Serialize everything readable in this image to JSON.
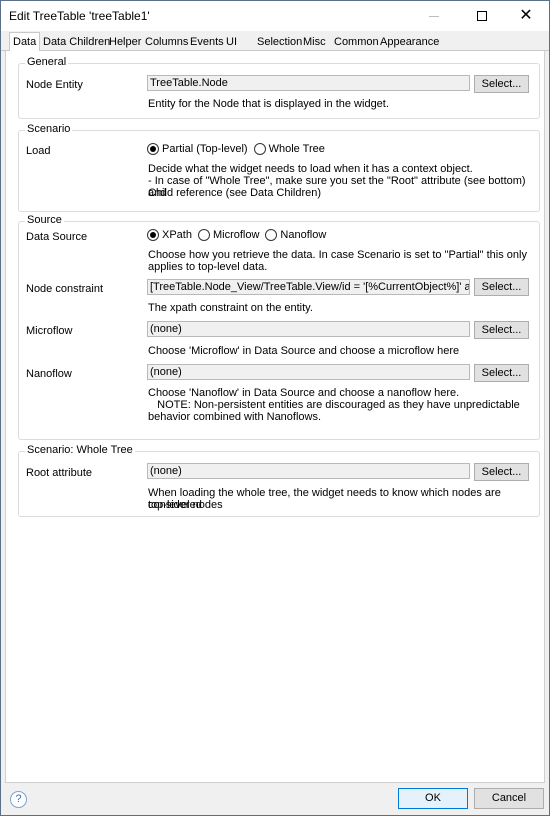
{
  "window": {
    "title": "Edit TreeTable 'treeTable1'"
  },
  "tabs": [
    {
      "label": "Data"
    },
    {
      "label": "Data Children"
    },
    {
      "label": "Helper"
    },
    {
      "label": "Columns"
    },
    {
      "label": "Events"
    },
    {
      "label": "UI"
    },
    {
      "label": "Selection"
    },
    {
      "label": "Misc"
    },
    {
      "label": "Common"
    },
    {
      "label": "Appearance"
    }
  ],
  "general": {
    "title": "General",
    "node_entity_label": "Node Entity",
    "node_entity_value": "TreeTable.Node",
    "select_label": "Select...",
    "help": "Entity for the Node that is displayed in the widget."
  },
  "scenario": {
    "title": "Scenario",
    "load_label": "Load",
    "options": [
      "Partial (Top-level)",
      "Whole Tree"
    ],
    "selected": "Partial (Top-level)",
    "help1": "Decide what the widget needs to load when it has a context object.",
    "help2": "- In case of \"Whole Tree\", make sure you set the \"Root\" attribute (see bottom) and",
    "help3": "Child reference (see Data Children)"
  },
  "source": {
    "title": "Source",
    "data_source_label": "Data Source",
    "options": [
      "XPath",
      "Microflow",
      "Nanoflow"
    ],
    "selected": "XPath",
    "data_source_help1": "Choose how you retrieve the data. In case Scenario is set to \"Partial\" this only",
    "data_source_help2": "applies to top-level data.",
    "node_constraint_label": "Node constraint",
    "node_constraint_value": "[TreeTable.Node_View/TreeTable.View/id = '[%CurrentObject%]' and _Ro",
    "node_constraint_help": "The xpath constraint on the entity.",
    "microflow_label": "Microflow",
    "microflow_value": "(none)",
    "microflow_help": "Choose 'Microflow' in Data Source and choose a microflow here",
    "nanoflow_label": "Nanoflow",
    "nanoflow_value": "(none)",
    "nanoflow_help1": "Choose 'Nanoflow' in Data Source and choose a nanoflow here.",
    "nanoflow_help2": "   NOTE: Non-persistent entities are discouraged as they have unpredictable",
    "nanoflow_help3": "behavior combined with Nanoflows."
  },
  "whole_tree": {
    "title": "Scenario: Whole Tree",
    "root_label": "Root attribute",
    "root_value": "(none)",
    "help1": "When loading the whole tree, the widget needs to know which nodes are considered",
    "help2": "top-level nodes"
  },
  "footer": {
    "help_glyph": "?",
    "ok_label": "OK",
    "cancel_label": "Cancel"
  }
}
